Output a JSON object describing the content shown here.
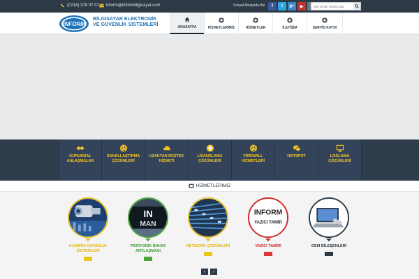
{
  "topbar": {
    "phone": "(0216) 378 07 07",
    "email": "inform@informbilgisayar.com",
    "social_label": "Sosyal Medyada Biz",
    "social_links": [
      {
        "icon": "facebook-icon",
        "glyph": "f",
        "color": "#3b5998"
      },
      {
        "icon": "twitter-icon",
        "glyph": "t",
        "color": "#2aa9e0"
      },
      {
        "icon": "google-plus-icon",
        "glyph": "g+",
        "color": "#3f86c5"
      },
      {
        "icon": "youtube-icon",
        "glyph": "▶",
        "color": "#c4302b"
      },
      {
        "icon": "rss-icon",
        "glyph": "≈",
        "color": "#6b7a88"
      }
    ],
    "search_placeholder": "Site içinde arama yap"
  },
  "header": {
    "logo_text": "INFORM",
    "company_line1": "BİLGİSAYAR ELEKTRONİK",
    "company_line2": "VE GÜVENLİK SİSTEMLERİ",
    "nav": [
      {
        "label": "ANASAYFA",
        "icon": "home-icon",
        "active": true
      },
      {
        "label": "HİZMETLERİMİZ",
        "icon": "plus-circle-icon",
        "active": false
      },
      {
        "label": "HİZMETLER",
        "icon": "plus-circle-icon",
        "active": false
      },
      {
        "label": "İLETİŞİM",
        "icon": "plus-circle-icon",
        "active": false
      },
      {
        "label": "SERVİS KAYDI",
        "icon": "plus-circle-icon",
        "active": false
      }
    ]
  },
  "services": [
    {
      "line1": "KURUMSAL",
      "line2": "ANLAŞMALAR",
      "icon": "handshake-icon"
    },
    {
      "line1": "SANALLAŞTIRMA",
      "line2": "ÇÖZÜMLERİ",
      "icon": "globe-icon"
    },
    {
      "line1": "UZAKTAN DESTEK",
      "line2": "HİZMETİ",
      "icon": "cloud-icon"
    },
    {
      "line1": "LİSANSLAMA",
      "line2": "ÇÖZÜMLERİ",
      "icon": "plus-circle-icon"
    },
    {
      "line1": "FIREWALL",
      "line2": "HİZMETLERİ",
      "icon": "globe-icon"
    },
    {
      "line1": "HOTSPOT",
      "line2": "",
      "icon": "chat-bubbles-icon"
    },
    {
      "line1": "LOGLAMA",
      "line2": "ÇÖZÜMLERİ",
      "icon": "monitor-icon"
    }
  ],
  "section": {
    "title": "HİZMETLERİMİZ",
    "icon": "film-icon"
  },
  "cards": [
    {
      "line1": "KAMERA GÜVENLİK",
      "line2": "SİSTEMLERİ",
      "label_color": "#e3b80f",
      "bar_color": "#e8c51c",
      "ring_color": "#e3c12b"
    },
    {
      "line1": "PERİYODİK BAKIM",
      "line2": "ANTLAŞMASI",
      "label_color": "#3a9c34",
      "bar_color": "#49a53b",
      "ring_color": "#4aa53a"
    },
    {
      "line1": "NETWORK ÇÖZÜMLERİ",
      "line2": "",
      "label_color": "#e3b80f",
      "bar_color": "#e8c51c",
      "ring_color": "#e3c12b"
    },
    {
      "line1": "YAZICI TAMİRİ",
      "line2": "",
      "label_color": "#d32a2a",
      "bar_color": "#d93636",
      "ring_color": "#d12a2a"
    },
    {
      "line1": "OEM BİLEŞENLERİ",
      "line2": "",
      "label_color": "#2d3a46",
      "bar_color": "#2d3a46",
      "ring_color": "#2d3a46"
    }
  ],
  "card_image_texts": {
    "periodic": "IN",
    "periodic2": "MAN",
    "printer1": "INFORM",
    "printer2": "YAZICI TAMİR"
  },
  "pager": {
    "prev": "‹",
    "next": "›"
  }
}
